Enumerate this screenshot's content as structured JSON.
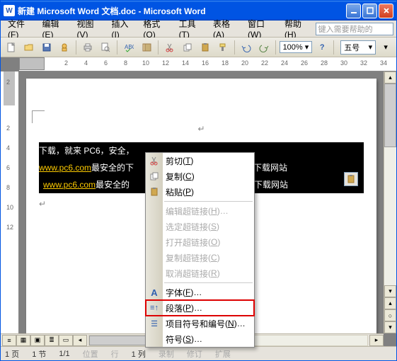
{
  "title": "新建 Microsoft Word 文档.doc - Microsoft Word",
  "menubar": {
    "file": "文件(F)",
    "edit": "编辑(E)",
    "view": "视图(V)",
    "insert": "插入(I)",
    "format": "格式(O)",
    "tools": "工具(T)",
    "table": "表格(A)",
    "window": "窗口(W)",
    "help": "帮助(H)",
    "ask_placeholder": "键入需要帮助的"
  },
  "toolbar": {
    "zoom": "100%",
    "font_size": "五号"
  },
  "ruler": {
    "marks": [
      "2",
      "4",
      "6",
      "8",
      "10",
      "12",
      "14",
      "16",
      "18",
      "20",
      "22",
      "24",
      "26",
      "28",
      "30",
      "32",
      "34"
    ]
  },
  "vruler": {
    "marks": [
      "2",
      "2",
      "4",
      "6",
      "8",
      "10",
      "12"
    ]
  },
  "document": {
    "line1_a": "下载，就来 PC6，安全，",
    "line2_link": "www.pc6.com",
    "line2_a": " 最安全的下",
    "line2_b": "全的下载网站",
    "line3_link": "www.pc6.com",
    "line3_a": " 最安全的",
    "line3_b": "全的下载网站",
    "para_mark": "↵"
  },
  "context_menu": {
    "cut": "剪切",
    "cut_key": "T",
    "copy": "复制",
    "copy_key": "C",
    "paste": "粘贴",
    "paste_key": "P",
    "edit_link": "编辑超链接",
    "edit_link_key": "H",
    "edit_link_suffix": "…",
    "select_link": "选定超链接",
    "select_link_key": "S",
    "open_link": "打开超链接",
    "open_link_key": "O",
    "copy_link": "复制超链接",
    "copy_link_key": "C",
    "remove_link": "取消超链接",
    "remove_link_key": "R",
    "font": "字体",
    "font_key": "F",
    "font_suffix": "…",
    "paragraph": "段落",
    "paragraph_key": "P",
    "paragraph_suffix": "…",
    "bullets": "项目符号和编号",
    "bullets_key": "N",
    "bullets_suffix": "…",
    "symbol": "符号",
    "symbol_key": "S",
    "symbol_suffix": "…"
  },
  "statusbar": {
    "page": "1 页",
    "section": "1 节",
    "pages": "1/1",
    "position": "位置",
    "line": "行",
    "col": "1 列",
    "rec": "录制",
    "rev": "修订",
    "ext": "扩展"
  }
}
